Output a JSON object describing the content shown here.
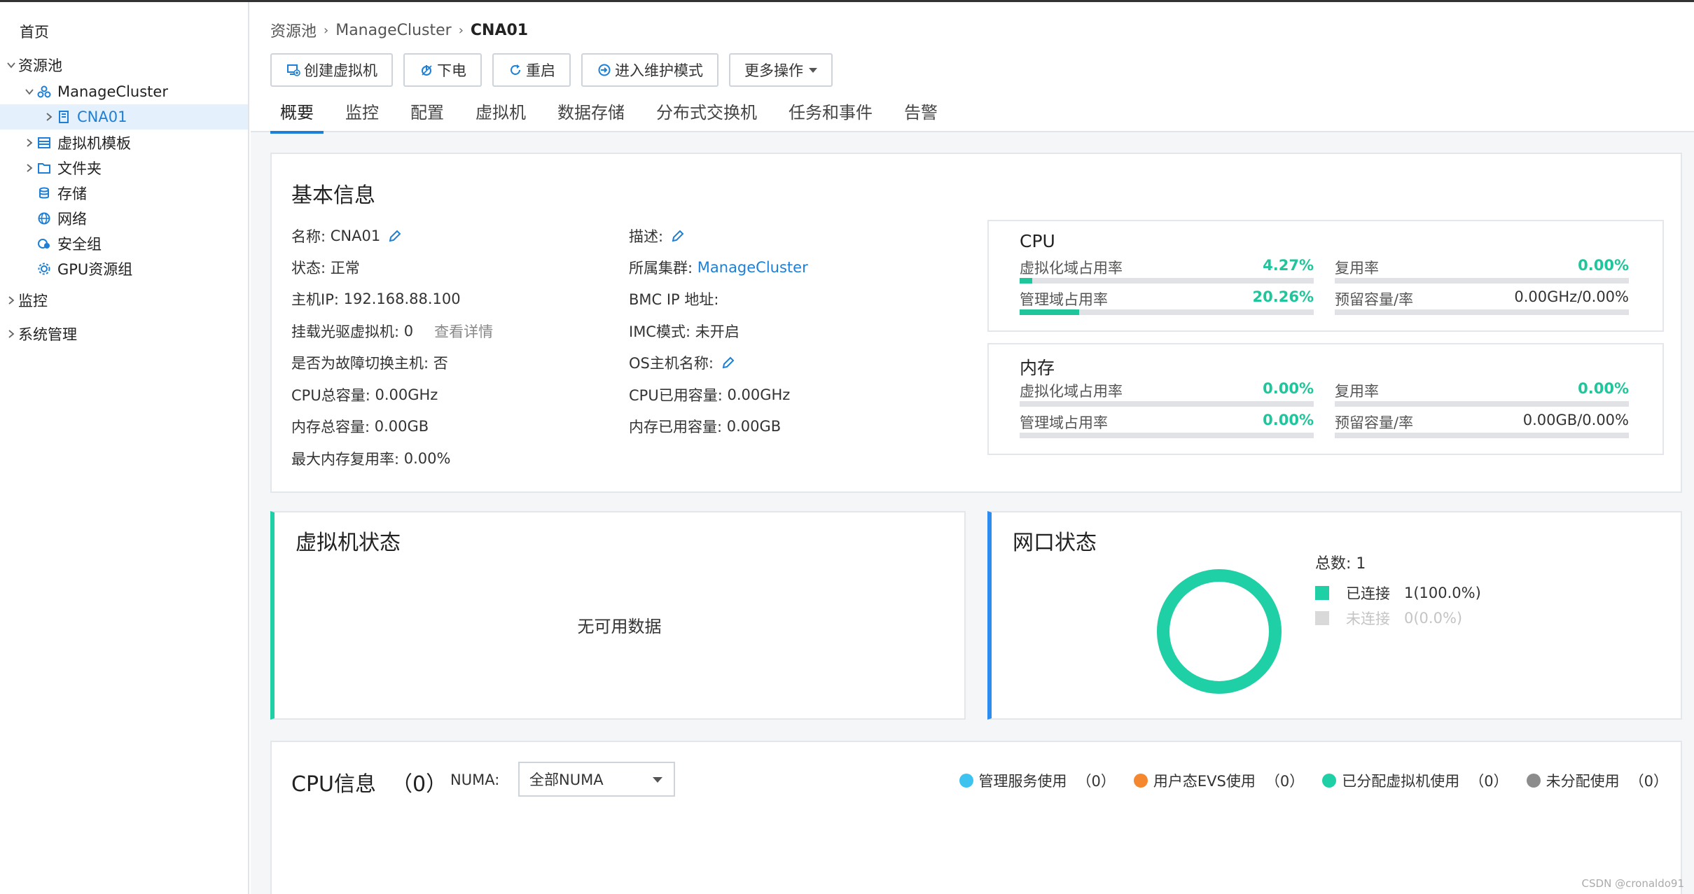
{
  "sidebar": {
    "home": "首页",
    "resource_pool": "资源池",
    "cluster": "ManageCluster",
    "host": "CNA01",
    "vm_template": "虚拟机模板",
    "folder": "文件夹",
    "storage": "存储",
    "network": "网络",
    "security_group": "安全组",
    "gpu_group": "GPU资源组",
    "monitor": "监控",
    "system": "系统管理"
  },
  "breadcrumb": [
    "资源池",
    "ManageCluster",
    "CNA01"
  ],
  "toolbar": {
    "create_vm": "创建虚拟机",
    "power_off": "下电",
    "restart": "重启",
    "maintenance": "进入维护模式",
    "more": "更多操作"
  },
  "tabs": [
    "概要",
    "监控",
    "配置",
    "虚拟机",
    "数据存储",
    "分布式交换机",
    "任务和事件",
    "告警"
  ],
  "basic": {
    "title": "基本信息",
    "name_k": "名称:",
    "name_v": "CNA01",
    "status_k": "状态:",
    "status_v": "正常",
    "ip_k": "主机IP:",
    "ip_v": "192.168.88.100",
    "cdrom_k": "挂载光驱虚拟机:",
    "cdrom_v": "0",
    "cdrom_link": "查看详情",
    "failover_k": "是否为故障切换主机:",
    "failover_v": "否",
    "cpu_total_k": "CPU总容量:",
    "cpu_total_v": "0.00GHz",
    "mem_total_k": "内存总容量:",
    "mem_total_v": "0.00GB",
    "max_mem_k": "最大内存复用率:",
    "max_mem_v": "0.00%",
    "desc_k": "描述:",
    "cluster_k": "所属集群:",
    "cluster_v": "ManageCluster",
    "bmc_k": "BMC IP 地址:",
    "imc_k": "IMC模式:",
    "imc_v": "未开启",
    "os_k": "OS主机名称:",
    "cpu_used_k": "CPU已用容量:",
    "cpu_used_v": "0.00GHz",
    "mem_used_k": "内存已用容量:",
    "mem_used_v": "0.00GB"
  },
  "cpu_box": {
    "title": "CPU",
    "virt_label": "虚拟化域占用率",
    "virt_val": "4.27%",
    "virt_pct": 4.27,
    "reuse_label": "复用率",
    "reuse_val": "0.00%",
    "reuse_pct": 0,
    "mgmt_label": "管理域占用率",
    "mgmt_val": "20.26%",
    "mgmt_pct": 20.26,
    "reserve_label": "预留容量/率",
    "reserve_val": "0.00GHz/0.00%",
    "reserve_pct": 0
  },
  "mem_box": {
    "title": "内存",
    "virt_label": "虚拟化域占用率",
    "virt_val": "0.00%",
    "virt_pct": 0,
    "reuse_label": "复用率",
    "reuse_val": "0.00%",
    "reuse_pct": 0,
    "mgmt_label": "管理域占用率",
    "mgmt_val": "0.00%",
    "mgmt_pct": 0,
    "reserve_label": "预留容量/率",
    "reserve_val": "0.00GB/0.00%",
    "reserve_pct": 0
  },
  "vm_status": {
    "title": "虚拟机状态",
    "empty": "无可用数据"
  },
  "nic_status": {
    "title": "网口状态",
    "total": "总数: 1",
    "connected_label": "已连接",
    "connected_val": "1(100.0%)",
    "disconnected_label": "未连接",
    "disconnected_val": "0(0.0%)",
    "connected_fraction": 1.0,
    "colors": {
      "connected": "#1fd0a6",
      "disconnected": "#d9d9d9"
    }
  },
  "cpu_info": {
    "title": "CPU信息",
    "count": "（0）",
    "numa_label": "NUMA:",
    "numa_selected": "全部NUMA",
    "legend": [
      {
        "label": "管理服务使用",
        "count": "（0）",
        "color": "#3ec3f0"
      },
      {
        "label": "用户态EVS使用",
        "count": "（0）",
        "color": "#f5882e"
      },
      {
        "label": "已分配虚拟机使用",
        "count": "（0）",
        "color": "#1fd0a6"
      },
      {
        "label": "未分配使用",
        "count": "（0）",
        "color": "#8c8c8c"
      }
    ]
  },
  "watermark": "CSDN @cronaldo91"
}
